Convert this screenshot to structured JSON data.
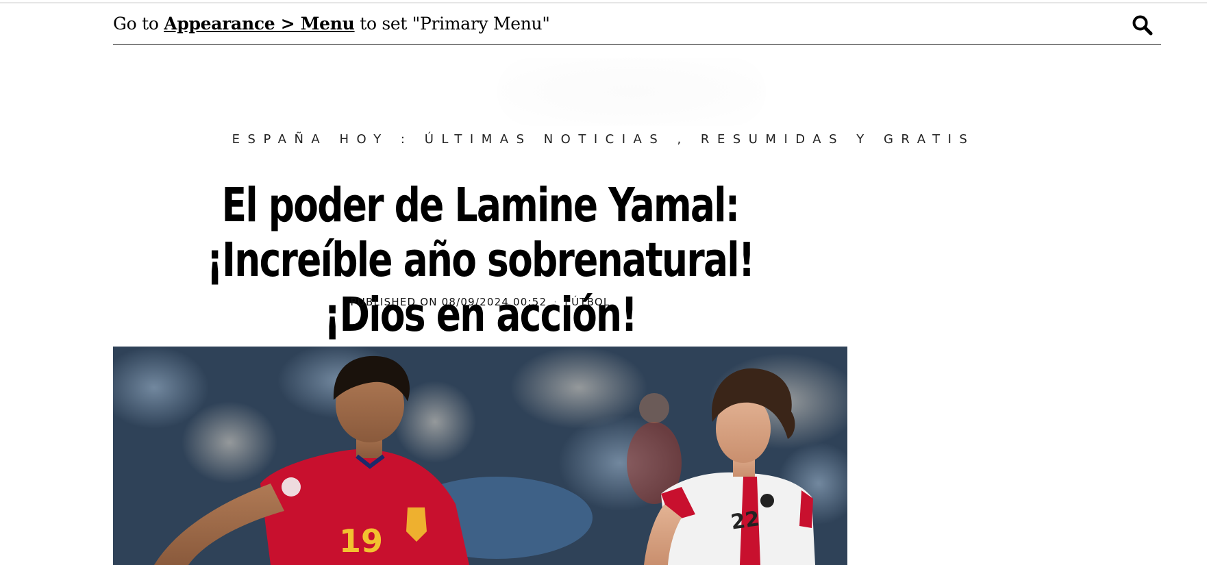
{
  "nav": {
    "message_prefix": "Go to ",
    "message_link": "Appearance > Menu",
    "message_suffix": " to set \"Primary Menu\"",
    "search_icon": "search-icon"
  },
  "site": {
    "tagline": "ESPAÑA HOY : ÚLTIMAS NOTICIAS , RESUMIDAS Y GRATIS"
  },
  "article": {
    "title": "El poder de Lamine Yamal: ¡Increíble año sobrenatural! ¡Dios en acción!",
    "published": "PUBLISHED ON 08/09/2024 00:52",
    "separator": "·",
    "category": "FÚTBOL"
  },
  "colors": {
    "spain_red": "#c8102e",
    "georgia_white": "#f2f2f2",
    "stadium_blue": "#3a4f6a"
  }
}
